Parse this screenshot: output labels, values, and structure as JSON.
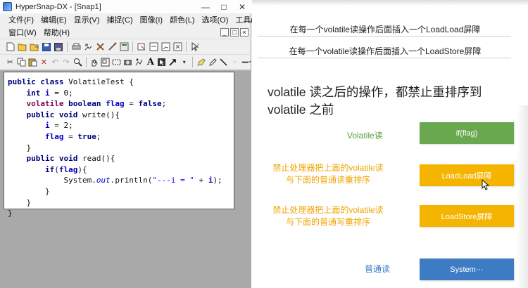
{
  "window": {
    "title": "HyperSnap-DX - [Snap1]",
    "min_glyph": "—",
    "max_glyph": "□",
    "close_glyph": "✕"
  },
  "menubar": {
    "items": [
      "文件(F)",
      "编辑(E)",
      "显示(V)",
      "捕捉(C)",
      "图像(I)",
      "颜色(L)",
      "选项(O)",
      "工具(T)"
    ],
    "items2": [
      "窗口(W)",
      "帮助(H)"
    ],
    "mdi_buttons": [
      "_",
      "□",
      "×"
    ]
  },
  "toolbar_icons": {
    "row1": [
      "new-icon",
      "open-icon",
      "open-recent-icon",
      "save-icon",
      "save-all-icon",
      "print-icon",
      "copy-image-icon",
      "settings-icon",
      "hotkey-icon",
      "capture-icon",
      "undo-icon",
      "redo-icon",
      "region-icon",
      "help-icon"
    ],
    "row2": [
      "cut-icon",
      "copy-icon",
      "paste-icon",
      "delete-icon",
      "undo-icon",
      "redo-icon",
      "zoom-icon",
      "hand-icon",
      "select-icon",
      "window-icon",
      "camera-icon",
      "stamp-icon",
      "text-icon",
      "pointer-icon",
      "arrow-icon",
      "highlighter-icon",
      "pen-icon",
      "line-icon",
      "line-style-icon"
    ]
  },
  "code": {
    "l1_kw": "public class",
    "l1_rest": " VolatileTest {",
    "l2_kw": "int",
    "l2_var": "i",
    "l2_rest": " = 0;",
    "l3_kw1": "volatile",
    "l3_kw2": "boolean",
    "l3_var": "flag",
    "l3_eq": " = ",
    "l3_val": "false",
    "l3_end": ";",
    "l4_kw": "public void",
    "l4_rest": " write(){",
    "l5_var": "i",
    "l5_rest": " = 2;",
    "l6_var": "flag",
    "l6_eq": " = ",
    "l6_val": "true",
    "l6_end": ";",
    "l7": "}",
    "l8_kw": "public void",
    "l8_rest": " read(){",
    "l9_kw": "if",
    "l9_open": "(",
    "l9_var": "flag",
    "l9_close": "){",
    "l10_a": "System.",
    "l10_out": "out",
    "l10_b": ".println(",
    "l10_str": "\"---i = \"",
    "l10_c": " + ",
    "l10_var": "i",
    "l10_d": ");",
    "l11": "}",
    "l12": "}",
    "l13": "}"
  },
  "slide": {
    "barrier_row_1": "在每一个volatile读操作后面插入一个LoadLoad屏障",
    "barrier_row_2": "在每一个volatile读操作后面插入一个LoadStore屏障",
    "heading": "volatile 读之后的操作，都禁止重排序到 volatile 之前",
    "label_volatile_read": "Volatile读",
    "label_loadload_l1": "禁止处理器把上面的volatile读",
    "label_loadload_l2": "与下面的普通读重排序",
    "label_loadstore_l1": "禁止处理器把上面的volatile读",
    "label_loadstore_l2": "与下面的普通写重排序",
    "label_normal_read": "普通读",
    "box_if_flag": "if(flag)",
    "box_loadload": "LoadLoad屏障",
    "box_loadstore": "LoadStore屏障",
    "box_system": "System···"
  },
  "colors": {
    "green": "#6aa84f",
    "orange": "#f5b400",
    "blue": "#3d7cc4",
    "orange_text": "#f0a400",
    "green_text": "#5a9e3a",
    "blue_text": "#3478c6"
  }
}
